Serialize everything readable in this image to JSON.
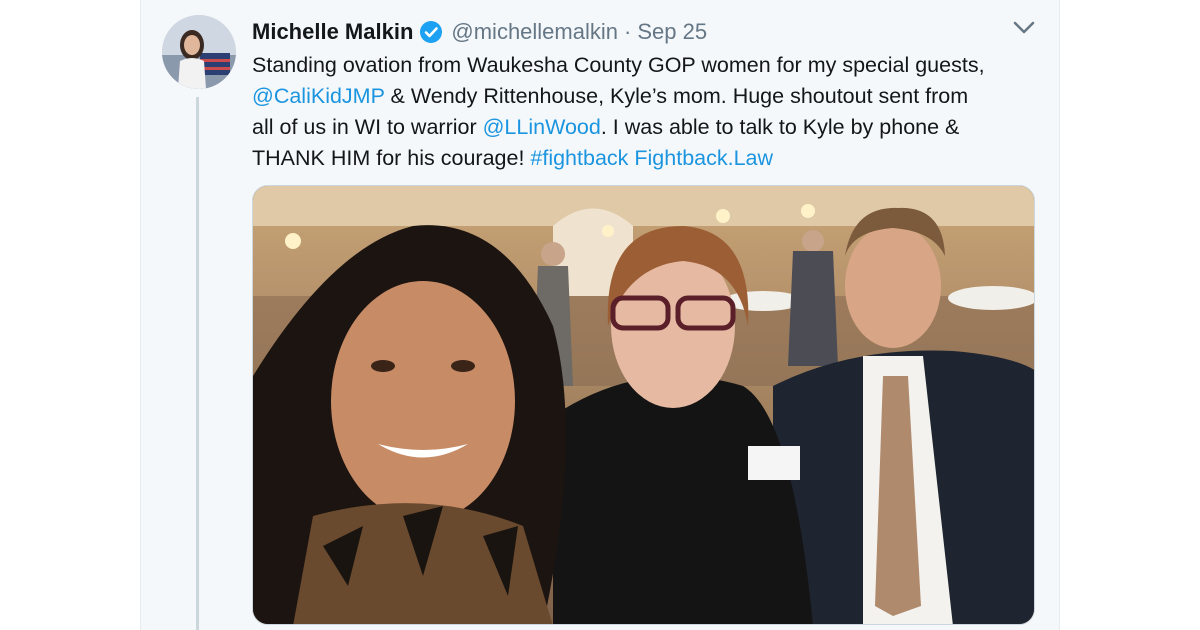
{
  "tweet": {
    "author_name": "Michelle Malkin",
    "handle": "@michellemalkin",
    "separator": "·",
    "date": "Sep 25",
    "text": {
      "l1": "Standing ovation from Waukesha County GOP women for my special guests,",
      "l2_link": "@CaliKidJMP",
      "l2_rest": " & Wendy Rittenhouse, Kyle’s mom.  Huge shoutout sent from",
      "l3_pre": "all of us in WI to warrior ",
      "l3_link": "@LLinWood",
      "l3_rest": ". I was able to talk to Kyle by phone &",
      "l4_pre": "THANK HIM for his courage! ",
      "l4_hashtag": "#fightback",
      "l4_space": " ",
      "l4_link": "Fightback.Law"
    }
  },
  "icons": {
    "verified": "verified-badge-icon",
    "caret": "chevron-down-icon"
  },
  "colors": {
    "link": "#1b95e0",
    "verified": "#1da1f2",
    "secondary_text": "#657786",
    "card_background": "#f5f8fa"
  }
}
